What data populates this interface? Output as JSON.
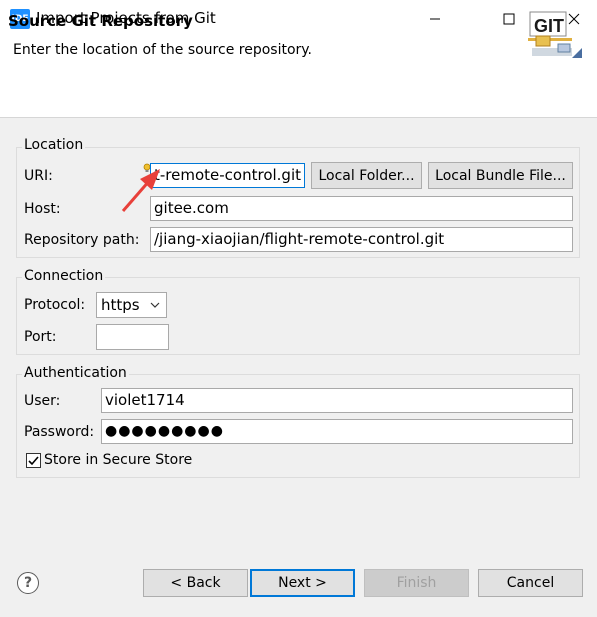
{
  "window": {
    "app_icon_text": "IDE",
    "title": "Import Projects from Git"
  },
  "header": {
    "title": "Source Git Repository",
    "description": "Enter the location of the source repository.",
    "logo_text": "GIT"
  },
  "location": {
    "group_label": "Location",
    "uri_label": "URI:",
    "uri_value": "t-remote-control.git",
    "local_folder_button": "Local Folder...",
    "local_bundle_button": "Local Bundle File...",
    "host_label": "Host:",
    "host_value": "gitee.com",
    "repo_path_label": "Repository path:",
    "repo_path_value": "/jiang-xiaojian/flight-remote-control.git"
  },
  "connection": {
    "group_label": "Connection",
    "protocol_label": "Protocol:",
    "protocol_value": "https",
    "port_label": "Port:",
    "port_value": ""
  },
  "authentication": {
    "group_label": "Authentication",
    "user_label": "User:",
    "user_value": "violet1714",
    "password_label": "Password:",
    "password_value": "●●●●●●●●●",
    "store_label": "Store in Secure Store",
    "store_checked": true
  },
  "footer": {
    "help": "?",
    "back": "< Back",
    "next": "Next >",
    "finish": "Finish",
    "cancel": "Cancel"
  },
  "colors": {
    "accent": "#0078d7",
    "annotation_arrow": "#e8403a"
  }
}
